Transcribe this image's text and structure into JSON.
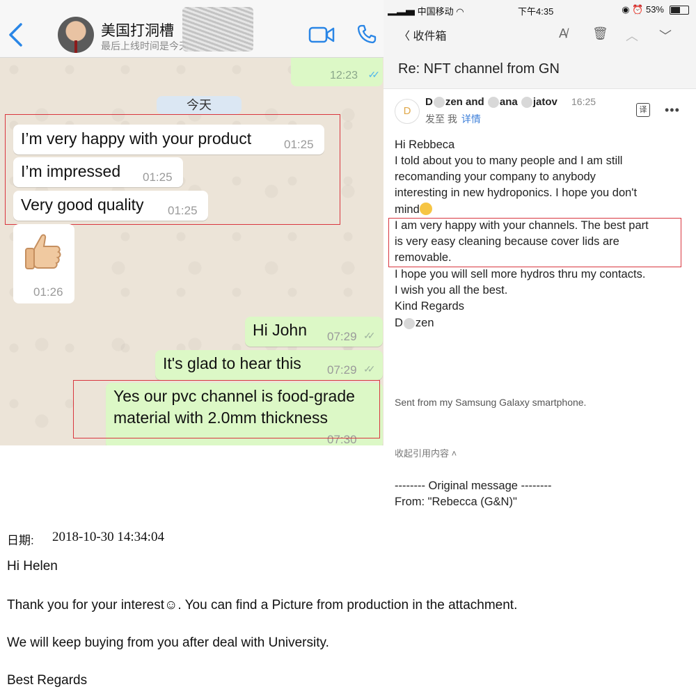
{
  "chat": {
    "contact_name": "美国打洞槽",
    "last_seen": "最后上线时间是今天",
    "earlier_time": "12:23",
    "date_label": "今天",
    "incoming": [
      {
        "text": "I’m very happy with your product",
        "time": "01:25"
      },
      {
        "text": "I’m impressed",
        "time": "01:25"
      },
      {
        "text": "Very good quality",
        "time": "01:25"
      }
    ],
    "thumbs_time": "01:26",
    "outgoing": [
      {
        "text": "Hi John",
        "time": "07:29"
      },
      {
        "text": "It's glad to hear this",
        "time": "07:29"
      },
      {
        "line1": "Yes our pvc channel is food-grade",
        "line2": "material with 2.0mm thickness",
        "time": "07:30"
      }
    ],
    "icons": [
      "back-icon",
      "video-call-icon",
      "phone-call-icon",
      "thumbs-up-emoji"
    ]
  },
  "email": {
    "status": {
      "carrier": "中国移动",
      "time": "下午4:35",
      "battery": "53%"
    },
    "nav": {
      "back_label": "收件箱"
    },
    "subject": "Re: NFT channel from GN",
    "sender": {
      "avatar_letter": "D",
      "name_a": "D",
      "name_b": "zen and",
      "name_c": "ana",
      "name_d": "jatov",
      "time": "16:25",
      "to": "发至 我",
      "details": "详情"
    },
    "body": [
      "Hi Rebbeca",
      "I told about you to many people and I am still",
      "recomanding your company to anybody",
      "interesting in new hydroponics. I hope you don't",
      "mind",
      "I am very happy with your channels. The best part",
      "is very easy cleaning because cover lids are",
      "removable.",
      "I hope you will sell more hydros  thru my contacts.",
      "I wish you all the best.",
      "Kind Regards",
      "D",
      "zen"
    ],
    "signature": "Sent from my Samsung Galaxy smartphone.",
    "collapse": "收起引用内容",
    "original_header": "-------- Original message --------",
    "original_from": "From: \"Rebecca (G&N)\""
  },
  "letter": {
    "date_label": "日期:",
    "date": "2018-10-30 14:34:04",
    "greeting": "Hi Helen",
    "line1": "Thank you for your interest☺. You can find a Picture from production in the attachment.",
    "line2": "We will keep buying from you after deal with University.",
    "closing": "Best Regards"
  }
}
